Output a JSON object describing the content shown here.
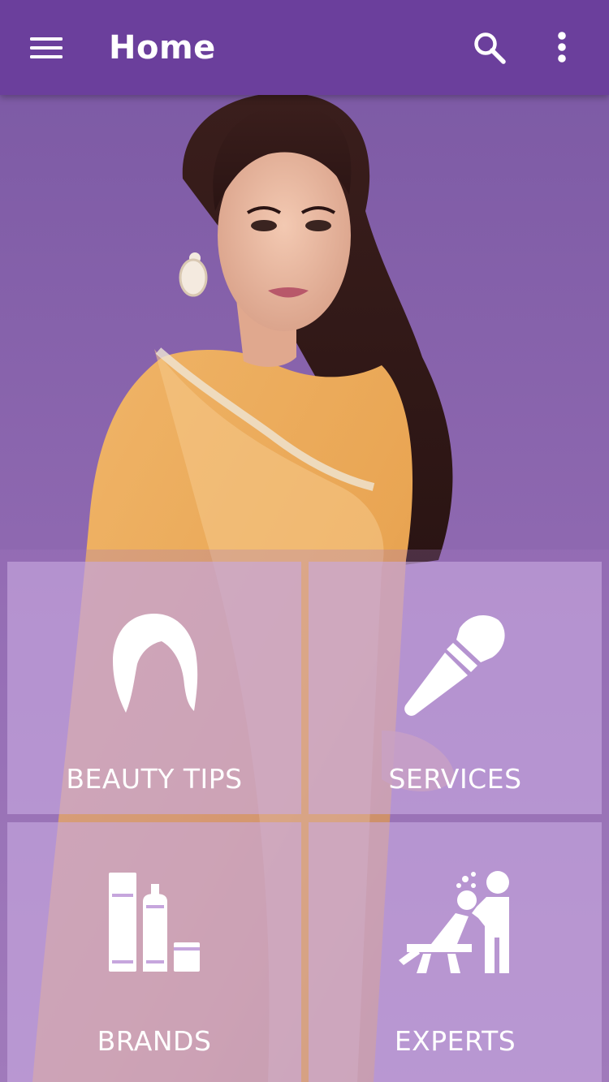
{
  "app_bar": {
    "title": "Home",
    "background_color": "#6b3f9c",
    "menu_icon": "hamburger-menu-icon",
    "search_icon": "search-icon",
    "more_icon": "more-vert-icon"
  },
  "hero": {
    "description_icon": "hero-banner-image"
  },
  "tiles": [
    {
      "label": "BEAUTY TIPS",
      "icon": "hair-icon"
    },
    {
      "label": "SERVICES",
      "icon": "makeup-brush-icon"
    },
    {
      "label": "BRANDS",
      "icon": "cosmetic-bottles-icon"
    },
    {
      "label": "EXPERTS",
      "icon": "salon-chair-stylist-icon"
    }
  ],
  "colors": {
    "tile_overlay": "#c8aae1",
    "background_purple": "#8a64ad",
    "text_on_purple": "#ffffff"
  }
}
